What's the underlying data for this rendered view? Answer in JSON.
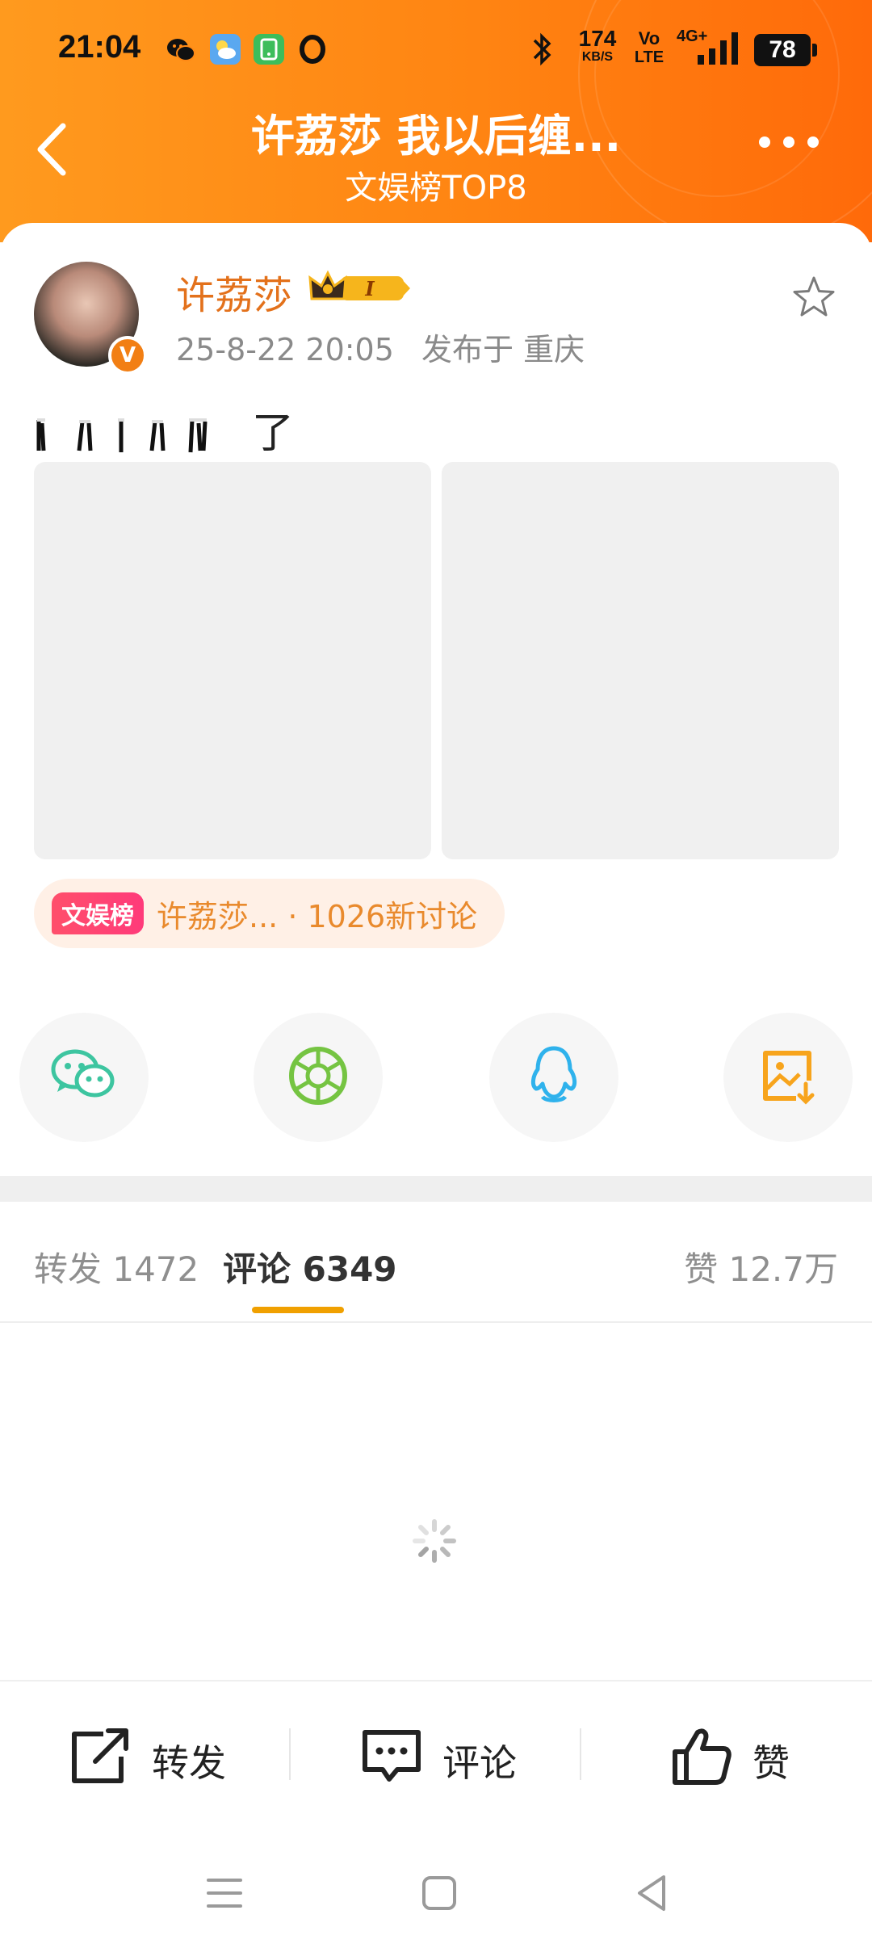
{
  "status_bar": {
    "time": "21:04",
    "net_speed_value": "174",
    "net_speed_unit": "KB/S",
    "volte_top": "Vo",
    "volte_bottom": "LTE",
    "network": "4G+",
    "battery": "78"
  },
  "header": {
    "title": "许荔莎 我以后缠...",
    "subtitle": "文娱榜TOP8"
  },
  "post": {
    "author": "许荔莎",
    "level_badge": "I",
    "timestamp": "25-8-22 20:05",
    "location": "发布于 重庆",
    "text": "了",
    "topic_tag": "文娱榜",
    "topic_text": "许荔莎... · 1026新讨论"
  },
  "tabs": {
    "repost": "转发 1472",
    "comments": "评论 6349",
    "likes": "赞 12.7万"
  },
  "actions": {
    "repost": "转发",
    "comment": "评论",
    "like": "赞"
  },
  "colors": {
    "header_orange": "#ff8412",
    "username_orange": "#e3711b",
    "tab_indicator": "#f0a000",
    "topic_bg": "#fff0e6"
  },
  "icons": [
    "wechat-icon",
    "moments-icon",
    "qq-icon",
    "save-image-icon",
    "star-icon",
    "back-arrow-icon",
    "more-icon",
    "repost-icon",
    "comment-icon",
    "like-icon",
    "loading-spinner-icon"
  ]
}
